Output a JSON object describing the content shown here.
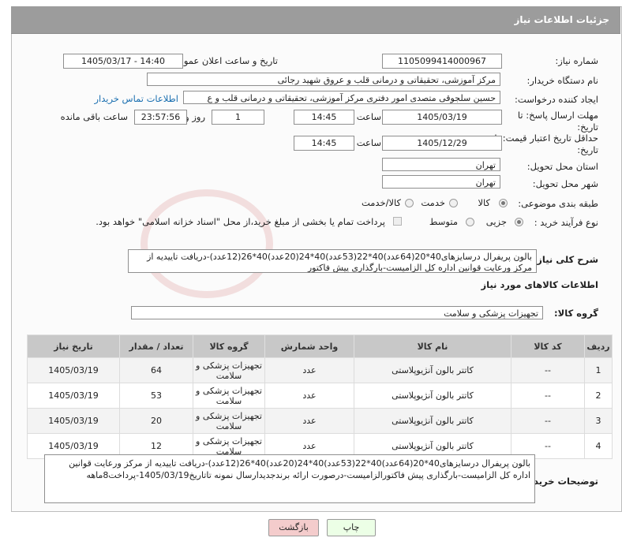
{
  "header": {
    "title": "جزئیات اطلاعات نیاز"
  },
  "form": {
    "need_number": {
      "label": "شماره نیاز:",
      "value": "1105099414000967"
    },
    "announce": {
      "label": "تاریخ و ساعت اعلان عمومی:",
      "value": "1405/03/17 - 14:40"
    },
    "buyer_org": {
      "label": "نام دستگاه خریدار:",
      "value": "مرکز آموزشی، تحقیقاتی و درمانی قلب و عروق شهید رجائی"
    },
    "requester": {
      "label": "ایجاد کننده درخواست:",
      "value": "حسین سلجوقی متصدی امور دفتری مرکز آموزشی، تحقیقاتی و درمانی قلب و ع",
      "contact_link": "اطلاعات تماس خریدار"
    },
    "deadline": {
      "label": "مهلت ارسال پاسخ: تا تاریخ:",
      "date": "1405/03/19",
      "time_label": "ساعت",
      "time": "14:45",
      "days": "1",
      "days_label": "روز و",
      "remaining": "23:57:56",
      "remaining_label": "ساعت باقی مانده"
    },
    "validity": {
      "label": "حداقل تاریخ اعتبار قیمت: تا تاریخ:",
      "date": "1405/12/29",
      "time_label": "ساعت",
      "time": "14:45"
    },
    "province": {
      "label": "استان محل تحویل:",
      "value": "تهران"
    },
    "city": {
      "label": "شهر محل تحویل:",
      "value": "تهران"
    },
    "category": {
      "label": "طبقه بندی موضوعی:",
      "options": [
        "کالا",
        "خدمت",
        "کالا/خدمت"
      ],
      "selected": "کالا"
    },
    "process": {
      "label": "نوع فرآیند خرید :",
      "options": [
        "جزیی",
        "متوسط"
      ],
      "selected": "جزیی",
      "payment_note": "پرداخت تمام یا بخشی از مبلغ خرید،از محل \"اسناد خزانه اسلامی\" خواهد بود."
    },
    "summary": {
      "label": "شرح کلی نیاز:",
      "value": "بالون پریفرال درسایزهای40*20(64عدد)40*22(53عدد)40*24(20عدد)40*26(12عدد)-دریافت تاییدیه از مرکز ورعایت قوانین اداره کل الزامیست-بارگذاری پیش فاکتور"
    }
  },
  "goods": {
    "section_title": "اطلاعات کالاهای مورد نیاز",
    "group_label": "گروه کالا:",
    "group_value": "تجهیزات پزشکی و سلامت",
    "columns": [
      "ردیف",
      "کد کالا",
      "نام کالا",
      "واحد شمارش",
      "گروه کالا",
      "تعداد / مقدار",
      "تاریخ نیاز"
    ],
    "rows": [
      {
        "idx": "1",
        "code": "--",
        "name": "کاتتر بالون آنژیوپلاستی",
        "unit": "عدد",
        "group": "تجهیزات پزشکی و سلامت",
        "qty": "64",
        "date": "1405/03/19"
      },
      {
        "idx": "2",
        "code": "--",
        "name": "کاتتر بالون آنژیوپلاستی",
        "unit": "عدد",
        "group": "تجهیزات پزشکی و سلامت",
        "qty": "53",
        "date": "1405/03/19"
      },
      {
        "idx": "3",
        "code": "--",
        "name": "کاتتر بالون آنژیوپلاستی",
        "unit": "عدد",
        "group": "تجهیزات پزشکی و سلامت",
        "qty": "20",
        "date": "1405/03/19"
      },
      {
        "idx": "4",
        "code": "--",
        "name": "کاتتر بالون آنژیوپلاستی",
        "unit": "عدد",
        "group": "تجهیزات پزشکی و سلامت",
        "qty": "12",
        "date": "1405/03/19"
      }
    ]
  },
  "buyer_notes": {
    "label": "توضیحات خریدار:",
    "value": "بالون پریفرال درسایزهای40*20(64عدد)40*22(53عدد)40*24(20عدد)40*26(12عدد)-دریافت تاییدیه از مرکز ورعایت قوانین اداره کل الزامیست-بارگذاری پیش فاکتورالزامیست-درصورت ارائه برندجدیدارسال نمونه تاتاریخ1405/03/19-پرداخت8ماهه"
  },
  "buttons": {
    "print": "چاپ",
    "back": "بازگشت"
  },
  "colors": {
    "header_bg": "#9c9c9c",
    "back_button_bg": "#f4cccc",
    "link": "#1a6fb0"
  }
}
